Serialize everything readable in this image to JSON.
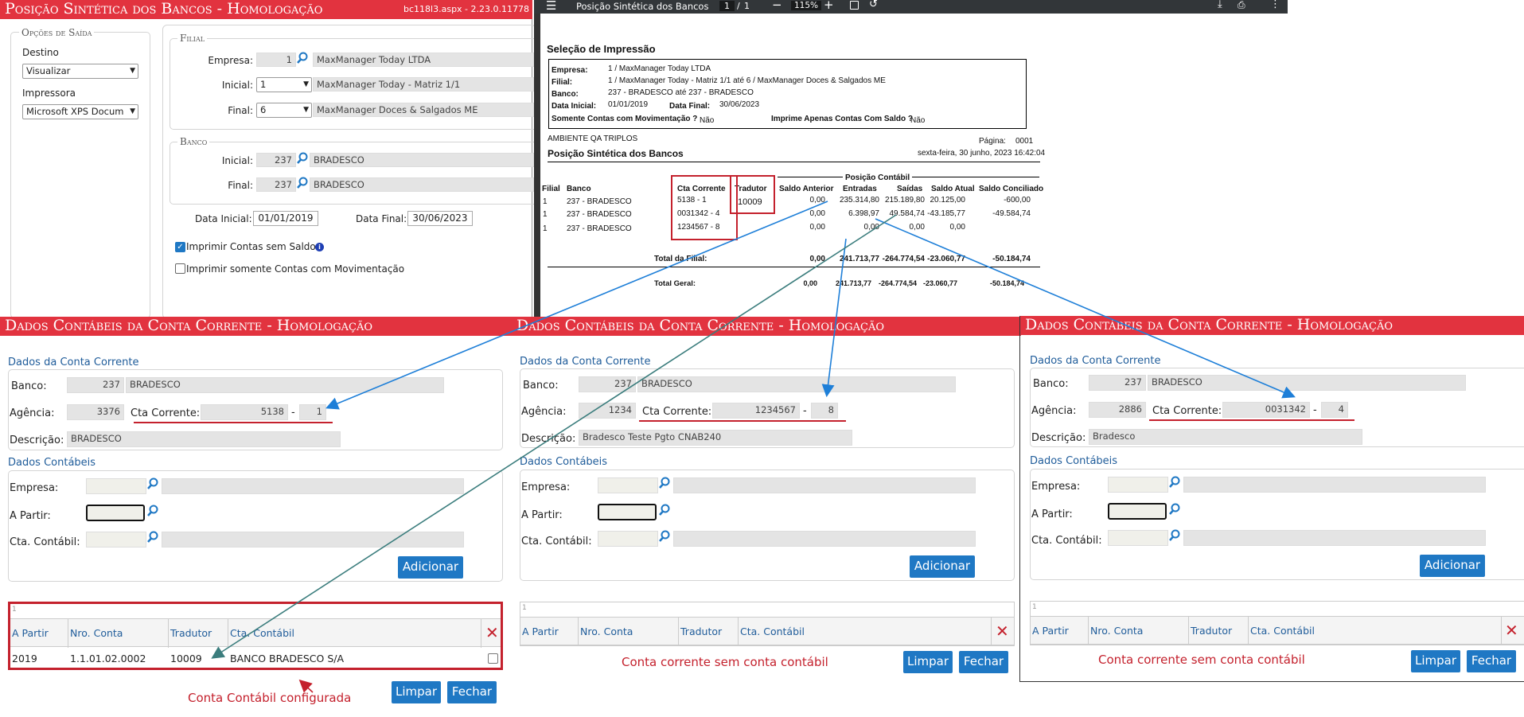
{
  "top_form": {
    "title": "Posição Sintética dos Bancos  - Homologação",
    "version": "bc118l3.aspx - 2.23.0.11778",
    "saida": {
      "legend": "Opções de Saída",
      "destino_label": "Destino",
      "destino_value": "Visualizar",
      "impressora_label": "Impressora",
      "impressora_value": "Microsoft XPS Docum"
    },
    "filial": {
      "legend": "Filial",
      "empresa_label": "Empresa:",
      "empresa_code": "1",
      "empresa_name": "MaxManager Today LTDA",
      "inicial_label": "Inicial:",
      "inicial_value": "1",
      "inicial_name": "MaxManager Today - Matriz 1/1",
      "final_label": "Final:",
      "final_value": "6",
      "final_name": "MaxManager Doces & Salgados ME"
    },
    "banco": {
      "legend": "Banco",
      "inicial_label": "Inicial:",
      "inicial_code": "237",
      "inicial_name": "BRADESCO",
      "final_label": "Final:",
      "final_code": "237",
      "final_name": "BRADESCO"
    },
    "data_inicial_label": "Data Inicial:",
    "data_inicial": "01/01/2019",
    "data_final_label": "Data Final:",
    "data_final": "30/06/2023",
    "check1_label": "Imprimir Contas sem Saldo",
    "check1_checked": true,
    "check2_label": "Imprimir somente Contas com Movimentação",
    "check2_checked": false
  },
  "pdf": {
    "title": "Posição Sintética dos Bancos",
    "page_current": "1",
    "page_sep": "/",
    "page_total": "1",
    "zoom": "115%",
    "report": {
      "selecao_title": "Seleção de Impressão",
      "empresa_label": "Empresa:",
      "empresa": "1 / MaxManager Today LTDA",
      "filial_label": "Filial:",
      "filial": "1 / MaxManager Today - Matriz 1/1 até 6 / MaxManager Doces & Salgados ME",
      "banco_label": "Banco:",
      "banco": "237 - BRADESCO até 237 - BRADESCO",
      "data_inicial_label": "Data Inicial:",
      "data_inicial": "01/01/2019",
      "data_final_label": "Data Final:",
      "data_final": "30/06/2023",
      "somente_label": "Somente Contas com Movimentação ?",
      "somente_value": "Não",
      "imprime_label": "Imprime Apenas Contas Com Saldo ?",
      "imprime_value": "Não",
      "ambiente": "AMBIENTE QA TRIPLOS",
      "pagina_label": "Página:",
      "pagina": "0001",
      "report_title": "Posição Sintética dos Bancos",
      "datetime": "sexta-feira, 30 junho, 2023  16:42:04",
      "posicao_contabil": "Posição Contábil",
      "columns": [
        "Filial",
        "Banco",
        "Cta Corrente",
        "Tradutor",
        "Saldo Anterior",
        "Entradas",
        "Saídas",
        "Saldo Atual",
        "Saldo Conciliado"
      ],
      "rows": [
        {
          "filial": "1",
          "banco": "237 - BRADESCO",
          "cta": "5138 - 1",
          "tradutor": "10009",
          "saldo_anterior": "0,00",
          "entradas": "235.314,80",
          "saidas": "215.189,80",
          "saldo_atual": "20.125,00",
          "saldo_conciliado": "-600,00"
        },
        {
          "filial": "1",
          "banco": "237 - BRADESCO",
          "cta": "0031342 - 4",
          "tradutor": "",
          "saldo_anterior": "0,00",
          "entradas": "6.398,97",
          "saidas": "49.584,74",
          "saldo_atual": "-43.185,77",
          "saldo_conciliado": "-49.584,74"
        },
        {
          "filial": "1",
          "banco": "237 - BRADESCO",
          "cta": "1234567 - 8",
          "tradutor": "",
          "saldo_anterior": "0,00",
          "entradas": "0,00",
          "saidas": "0,00",
          "saldo_atual": "0,00",
          "saldo_conciliado": ""
        }
      ],
      "total_filial_label": "Total da Filial:",
      "total_filial": [
        "0,00",
        "241.713,77",
        "-264.774,54",
        "-23.060,77",
        "-50.184,74"
      ],
      "total_geral_label": "Total Geral:",
      "total_geral": [
        "0,00",
        "241.713,77",
        "-264.774,54",
        "-23.060,77",
        "-50.184,74"
      ]
    }
  },
  "panels": [
    {
      "title": "Dados Contábeis da Conta Corrente  - Homologação",
      "section1": "Dados da Conta Corrente",
      "banco_label": "Banco:",
      "banco_code": "237",
      "banco_name": "BRADESCO",
      "agencia_label": "Agência:",
      "agencia": "3376",
      "cta_label": "Cta Corrente:",
      "cta": "5138",
      "cta_sep": "-",
      "dig": "1",
      "descricao_label": "Descrição:",
      "descricao": "BRADESCO",
      "section2": "Dados Contábeis",
      "empresa_label": "Empresa:",
      "apartir_label": "A Partir:",
      "ctacont_label": "Cta. Contábil:",
      "adicionar": "Adicionar",
      "grid_page": "1",
      "grid_headers": [
        "A Partir",
        "Nro. Conta",
        "Tradutor",
        "Cta. Contábil"
      ],
      "grid_rows": [
        {
          "a_partir": "2019",
          "nro_conta": "1.1.01.02.0002",
          "tradutor": "10009",
          "cta_contabil": "BANCO BRADESCO S/A"
        }
      ],
      "limpar": "Limpar",
      "fechar": "Fechar",
      "caption": "Conta Contábil configurada"
    },
    {
      "title": "Dados Contábeis da Conta Corrente  - Homologação",
      "section1": "Dados da Conta Corrente",
      "banco_label": "Banco:",
      "banco_code": "237",
      "banco_name": "BRADESCO",
      "agencia_label": "Agência:",
      "agencia": "1234",
      "cta_label": "Cta Corrente:",
      "cta": "1234567",
      "cta_sep": "-",
      "dig": "8",
      "descricao_label": "Descrição:",
      "descricao": "Bradesco Teste Pgto CNAB240",
      "section2": "Dados Contábeis",
      "empresa_label": "Empresa:",
      "apartir_label": "A Partir:",
      "ctacont_label": "Cta. Contábil:",
      "adicionar": "Adicionar",
      "grid_page": "1",
      "grid_headers": [
        "A Partir",
        "Nro. Conta",
        "Tradutor",
        "Cta. Contábil"
      ],
      "grid_rows": [],
      "limpar": "Limpar",
      "fechar": "Fechar",
      "caption": "Conta corrente sem conta contábil"
    },
    {
      "title": "Dados Contábeis da Conta Corrente  - Homologação",
      "section1": "Dados da Conta Corrente",
      "banco_label": "Banco:",
      "banco_code": "237",
      "banco_name": "BRADESCO",
      "agencia_label": "Agência:",
      "agencia": "2886",
      "cta_label": "Cta Corrente:",
      "cta": "0031342",
      "cta_sep": "-",
      "dig": "4",
      "descricao_label": "Descrição:",
      "descricao": "Bradesco",
      "section2": "Dados Contábeis",
      "empresa_label": "Empresa:",
      "apartir_label": "A Partir:",
      "ctacont_label": "Cta. Contábil:",
      "adicionar": "Adicionar",
      "grid_page": "1",
      "grid_headers": [
        "A Partir",
        "Nro. Conta",
        "Tradutor",
        "Cta. Contábil"
      ],
      "grid_rows": [],
      "limpar": "Limpar",
      "fechar": "Fechar",
      "caption": "Conta corrente sem conta contábil"
    }
  ],
  "colors": {
    "title_red": "#e2333f",
    "accent_blue": "#1f78c4",
    "annotation_red": "#c4212d",
    "arrow_blue": "#1e7fd8",
    "arrow_teal": "#3b7d7d"
  }
}
